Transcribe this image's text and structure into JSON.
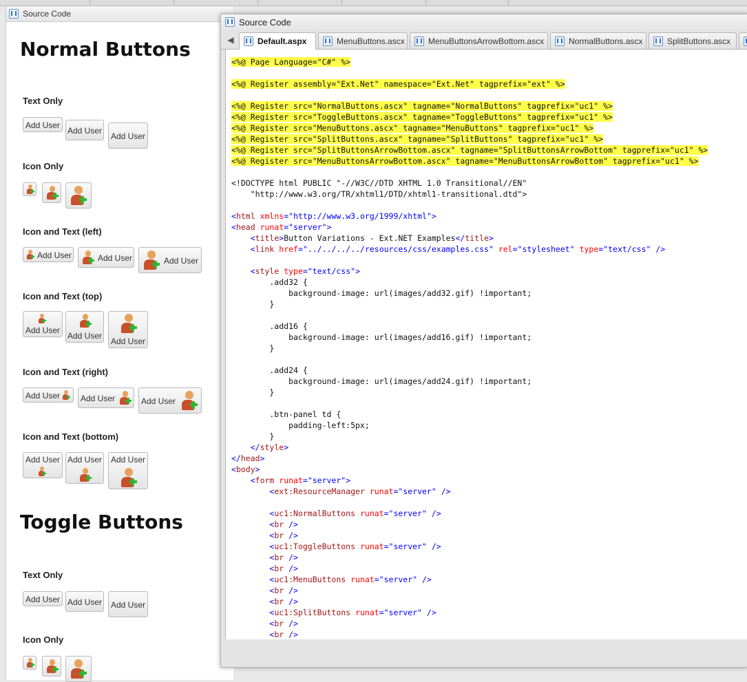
{
  "left_panel": {
    "title": "Source Code",
    "headings": {
      "normal": "Normal Buttons",
      "toggle": "Toggle Buttons"
    },
    "sections": {
      "text_only": "Text Only",
      "icon_only": "Icon Only",
      "icon_text_left": "Icon and Text (left)",
      "icon_text_top": "Icon and Text (top)",
      "icon_text_right": "Icon and Text (right)",
      "icon_text_bottom": "Icon and Text (bottom)"
    },
    "button_label": "Add User"
  },
  "source_window": {
    "title": "Source Code",
    "tabs": [
      "Default.aspx",
      "MenuButtons.ascx",
      "MenuButtonsArrowBottom.ascx",
      "NormalButtons.ascx",
      "SplitButtons.ascx"
    ],
    "active_tab": "Default.aspx",
    "code": {
      "l1": "<%@ Page Language=\"C#\" %>",
      "l2": "<%@ Register assembly=\"Ext.Net\" namespace=\"Ext.Net\" tagprefix=\"ext\" %>",
      "l3": "<%@ Register src=\"NormalButtons.ascx\" tagname=\"NormalButtons\" tagprefix=\"uc1\" %>",
      "l4": "<%@ Register src=\"ToggleButtons.ascx\" tagname=\"ToggleButtons\" tagprefix=\"uc1\" %>",
      "l5": "<%@ Register src=\"MenuButtons.ascx\" tagname=\"MenuButtons\" tagprefix=\"uc1\" %>",
      "l6": "<%@ Register src=\"SplitButtons.ascx\" tagname=\"SplitButtons\" tagprefix=\"uc1\" %>",
      "l7": "<%@ Register src=\"SplitButtonsArrowBottom.ascx\" tagname=\"SplitButtonsArrowBottom\" tagprefix=\"uc1\" %>",
      "l8": "<%@ Register src=\"MenuButtonsArrowBottom.ascx\" tagname=\"MenuButtonsArrowBottom\" tagprefix=\"uc1\" %>",
      "doctype1": "<!DOCTYPE html PUBLIC \"-//W3C//DTD XHTML 1.0 Transitional//EN\"",
      "doctype2": "    \"http://www.w3.org/TR/xhtml1/DTD/xhtml1-transitional.dtd\">",
      "html_xmlns": "http://www.w3.org/1999/xhtml",
      "title_text": "Button Variations - Ext.NET Examples",
      "link_href": "../../../../resources/css/examples.css",
      "css_add32_sel": "        .add32 {",
      "css_add32_body": "            background-image: url(images/add32.gif) !important;",
      "css_add16_sel": "        .add16 {",
      "css_add16_body": "            background-image: url(images/add16.gif) !important;",
      "css_add24_sel": "        .add24 {",
      "css_add24_body": "            background-image: url(images/add24.gif) !important;",
      "css_btn_sel": "        .btn-panel td {",
      "css_btn_body": "            padding-left:5px;",
      "css_close": "        }"
    }
  }
}
